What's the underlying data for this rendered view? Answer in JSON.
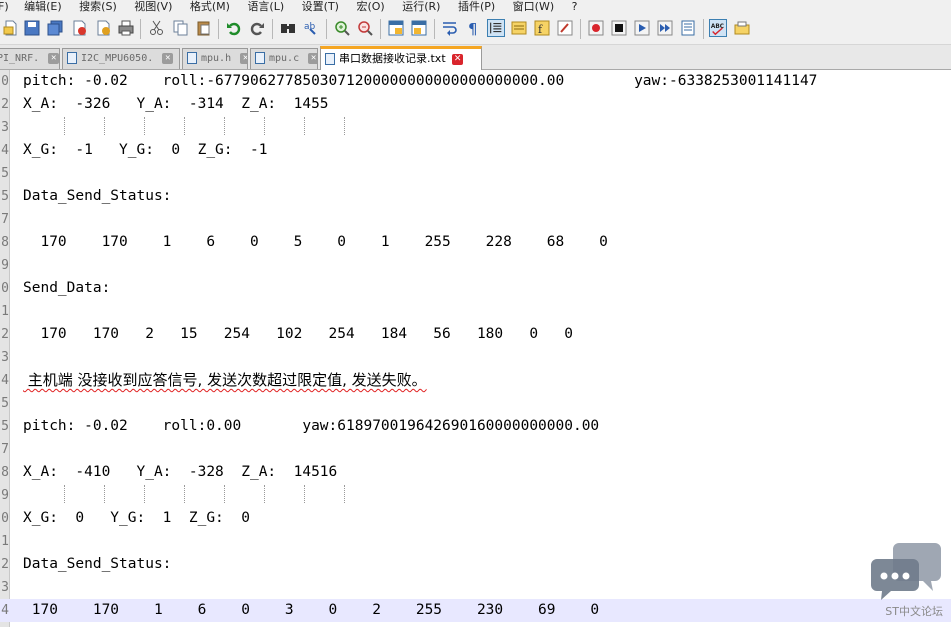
{
  "menu": [
    "F)",
    "编辑(E)",
    "搜索(S)",
    "视图(V)",
    "格式(M)",
    "语言(L)",
    "设置(T)",
    "宏(O)",
    "运行(R)",
    "插件(P)",
    "窗口(W)",
    "?"
  ],
  "toolbar": {
    "icons": [
      "new-file-icon",
      "open-file-icon",
      "save-icon",
      "save-all-icon",
      "close-icon",
      "close-all-icon",
      "print-icon",
      "cut-icon",
      "copy-icon",
      "paste-icon",
      "undo-icon",
      "redo-icon",
      "find-icon",
      "replace-icon",
      "zoom-in-icon",
      "zoom-out-icon",
      "sync-vertical-icon",
      "sync-horizontal-icon",
      "word-wrap-icon",
      "show-all-chars-icon",
      "indent-guide-icon",
      "doc-map-icon",
      "function-list-icon",
      "folder-workspace-icon",
      "record-macro-icon",
      "stop-macro-icon",
      "play-macro-icon",
      "run-macro-multiple-icon",
      "save-macro-icon",
      "spell-check-icon",
      "spell-settings-icon"
    ],
    "accent": "#3c7fb1"
  },
  "tabs": [
    {
      "label": "PI_NRF.",
      "active": false
    },
    {
      "label": "I2C_MPU6050.",
      "active": false
    },
    {
      "label": "mpu.h",
      "active": false
    },
    {
      "label": "mpu.c",
      "active": false
    },
    {
      "label": "串口数据接收记录.txt",
      "active": true
    }
  ],
  "editor": {
    "lines": [
      {
        "num": "0",
        "text": "pitch: -0.02    roll:-6779062778503071200000000000000000000.00        yaw:-6338253001141147"
      },
      {
        "num": "2",
        "text": "X_A:  -326   Y_A:  -314  Z_A:  1455"
      },
      {
        "num": "3",
        "text": ""
      },
      {
        "num": "4",
        "text": "X_G:  -1   Y_G:  0  Z_G:  -1"
      },
      {
        "num": "5",
        "text": ""
      },
      {
        "num": "5",
        "text": "Data_Send_Status:"
      },
      {
        "num": "7",
        "text": ""
      },
      {
        "num": "8",
        "text": "  170    170    1    6    0    5    0    1    255    228    68    0"
      },
      {
        "num": "9",
        "text": ""
      },
      {
        "num": "0",
        "text": "Send_Data:"
      },
      {
        "num": "1",
        "text": ""
      },
      {
        "num": "2",
        "text": "  170   170   2   15   254   102   254   184   56   180   0   0"
      },
      {
        "num": "3",
        "text": ""
      },
      {
        "num": "4",
        "text": " 主机端 没接收到应答信号, 发送次数超过限定值, 发送失败。"
      },
      {
        "num": "5",
        "text": ""
      },
      {
        "num": "5",
        "text": "pitch: -0.02    roll:0.00       yaw:618970019642690160000000000.00"
      },
      {
        "num": "7",
        "text": ""
      },
      {
        "num": "8",
        "text": "X_A:  -410   Y_A:  -328  Z_A:  14516"
      },
      {
        "num": "9",
        "text": ""
      },
      {
        "num": "0",
        "text": "X_G:  0   Y_G:  1  Z_G:  0"
      },
      {
        "num": "1",
        "text": ""
      },
      {
        "num": "2",
        "text": "Data_Send_Status:"
      },
      {
        "num": "3",
        "text": ""
      },
      {
        "num": "4",
        "text": " 170    170    1    6    0    3    0    2    255    230    69    0"
      }
    ],
    "current_line_color": "#e8e8ff"
  },
  "watermark": {
    "text": "ST中文论坛",
    "icon": "chat-bubbles-icon",
    "color": "#8a8a8a"
  }
}
